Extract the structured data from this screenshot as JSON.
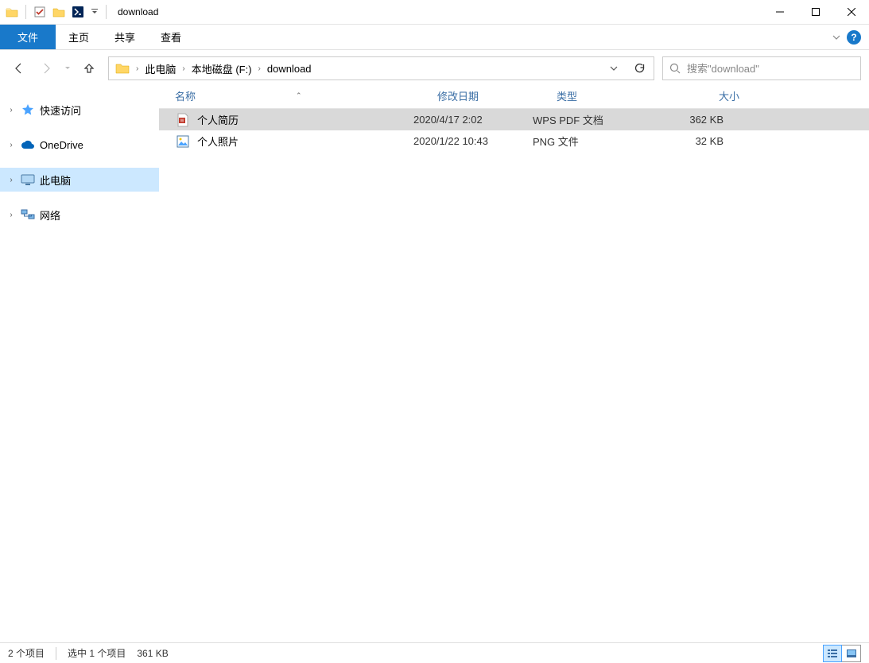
{
  "window": {
    "title": "download"
  },
  "ribbon": {
    "file": "文件",
    "tabs": [
      "主页",
      "共享",
      "查看"
    ]
  },
  "breadcrumbs": [
    "此电脑",
    "本地磁盘 (F:)",
    "download"
  ],
  "search": {
    "placeholder": "搜索\"download\""
  },
  "nav_items": [
    {
      "label": "快速访问",
      "icon": "star",
      "selected": false
    },
    {
      "label": "OneDrive",
      "icon": "cloud",
      "selected": false
    },
    {
      "label": "此电脑",
      "icon": "pc",
      "selected": true
    },
    {
      "label": "网络",
      "icon": "network",
      "selected": false
    }
  ],
  "columns": {
    "name": "名称",
    "date": "修改日期",
    "type": "类型",
    "size": "大小"
  },
  "files": [
    {
      "name": "个人简历",
      "date": "2020/4/17 2:02",
      "type": "WPS PDF 文档",
      "size": "362 KB",
      "icon": "pdf",
      "selected": true
    },
    {
      "name": "个人照片",
      "date": "2020/1/22 10:43",
      "type": "PNG 文件",
      "size": "32 KB",
      "icon": "image",
      "selected": false
    }
  ],
  "status": {
    "count": "2 个项目",
    "selected": "选中 1 个项目",
    "size": "361 KB"
  }
}
